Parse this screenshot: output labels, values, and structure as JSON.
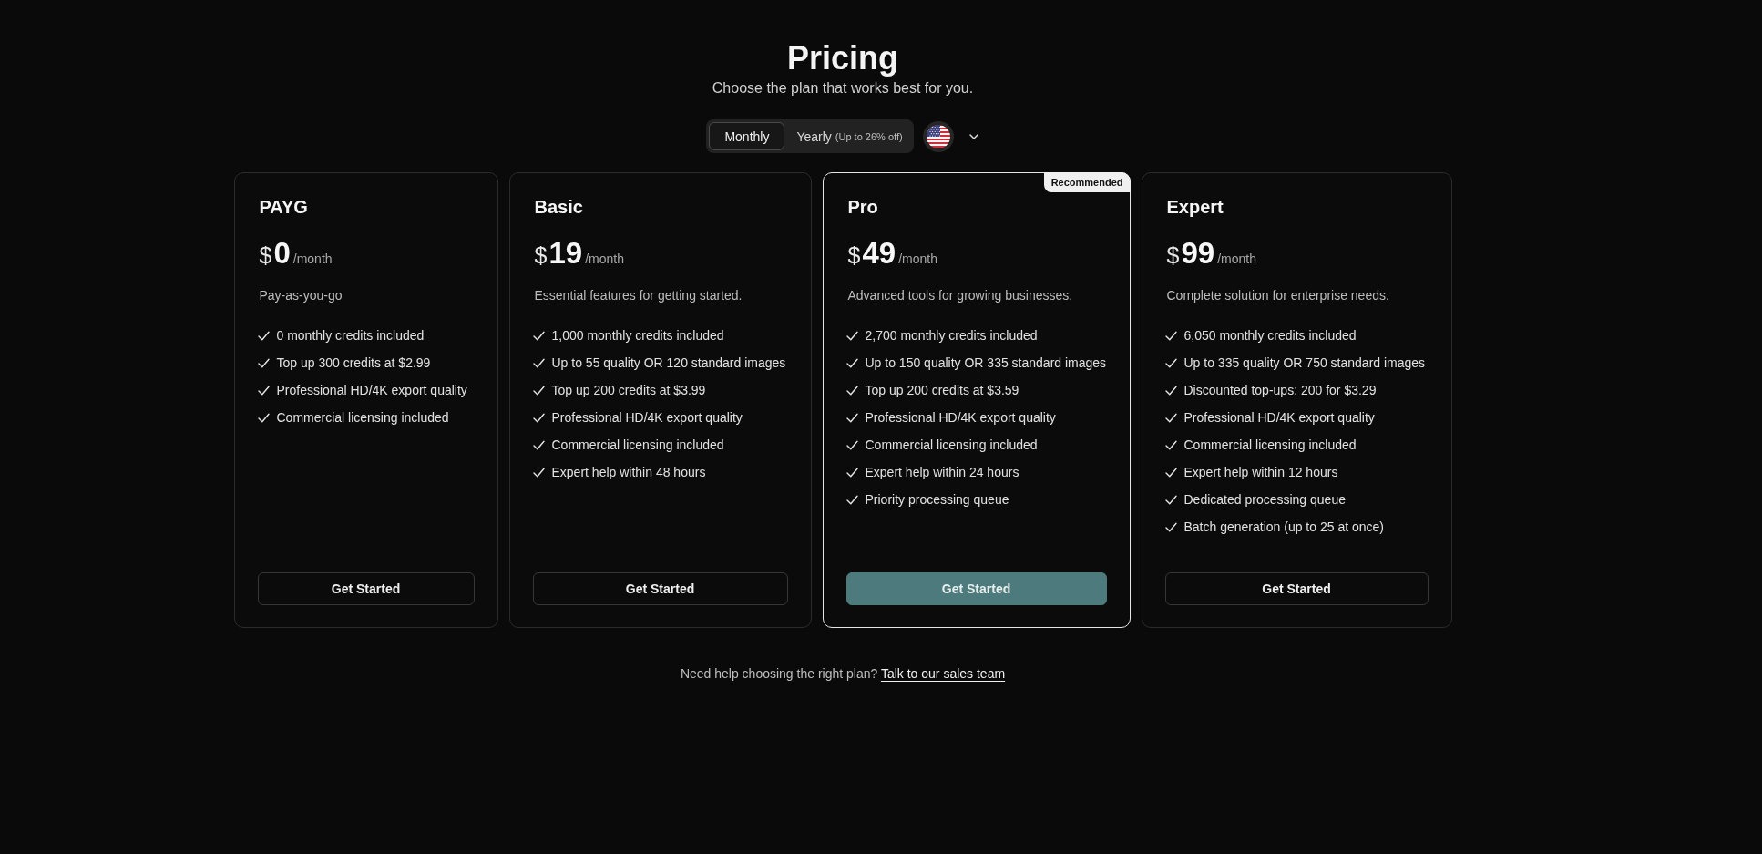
{
  "header": {
    "title": "Pricing",
    "subtitle": "Choose the plan that works best for you."
  },
  "billing_toggle": {
    "options": [
      {
        "label": "Monthly",
        "selected": true
      },
      {
        "label": "Yearly",
        "note": "(Up to 26% off)",
        "selected": false
      }
    ]
  },
  "plans": [
    {
      "name": "PAYG",
      "currency": "$",
      "price": "0",
      "period": "/month",
      "description": "Pay-as-you-go",
      "features": [
        "0 monthly credits included",
        "Top up 300 credits at $2.99",
        "Professional HD/4K export quality",
        "Commercial licensing included"
      ],
      "button": "Get Started",
      "featured": false
    },
    {
      "name": "Basic",
      "currency": "$",
      "price": "19",
      "period": "/month",
      "description": "Essential features for getting started.",
      "features": [
        "1,000 monthly credits included",
        "Up to 55 quality OR 120 standard images",
        "Top up 200 credits at $3.99",
        "Professional HD/4K export quality",
        "Commercial licensing included",
        "Expert help within 48 hours"
      ],
      "button": "Get Started",
      "featured": false
    },
    {
      "name": "Pro",
      "badge": "Recommended",
      "currency": "$",
      "price": "49",
      "period": "/month",
      "description": "Advanced tools for growing businesses.",
      "features": [
        "2,700 monthly credits included",
        "Up to 150 quality OR 335 standard images",
        "Top up 200 credits at $3.59",
        "Professional HD/4K export quality",
        "Commercial licensing included",
        "Expert help within 24 hours",
        "Priority processing queue"
      ],
      "button": "Get Started",
      "featured": true
    },
    {
      "name": "Expert",
      "currency": "$",
      "price": "99",
      "period": "/month",
      "description": "Complete solution for enterprise needs.",
      "features": [
        "6,050 monthly credits included",
        "Up to 335 quality OR 750 standard images",
        "Discounted top-ups: 200 for $3.29",
        "Professional HD/4K export quality",
        "Commercial licensing included",
        "Expert help within 12 hours",
        "Dedicated processing queue",
        "Batch generation (up to 25 at once)"
      ],
      "button": "Get Started",
      "featured": false
    }
  ],
  "footer": {
    "text": "Need help choosing the right plan?",
    "link": "Talk to our sales team"
  }
}
